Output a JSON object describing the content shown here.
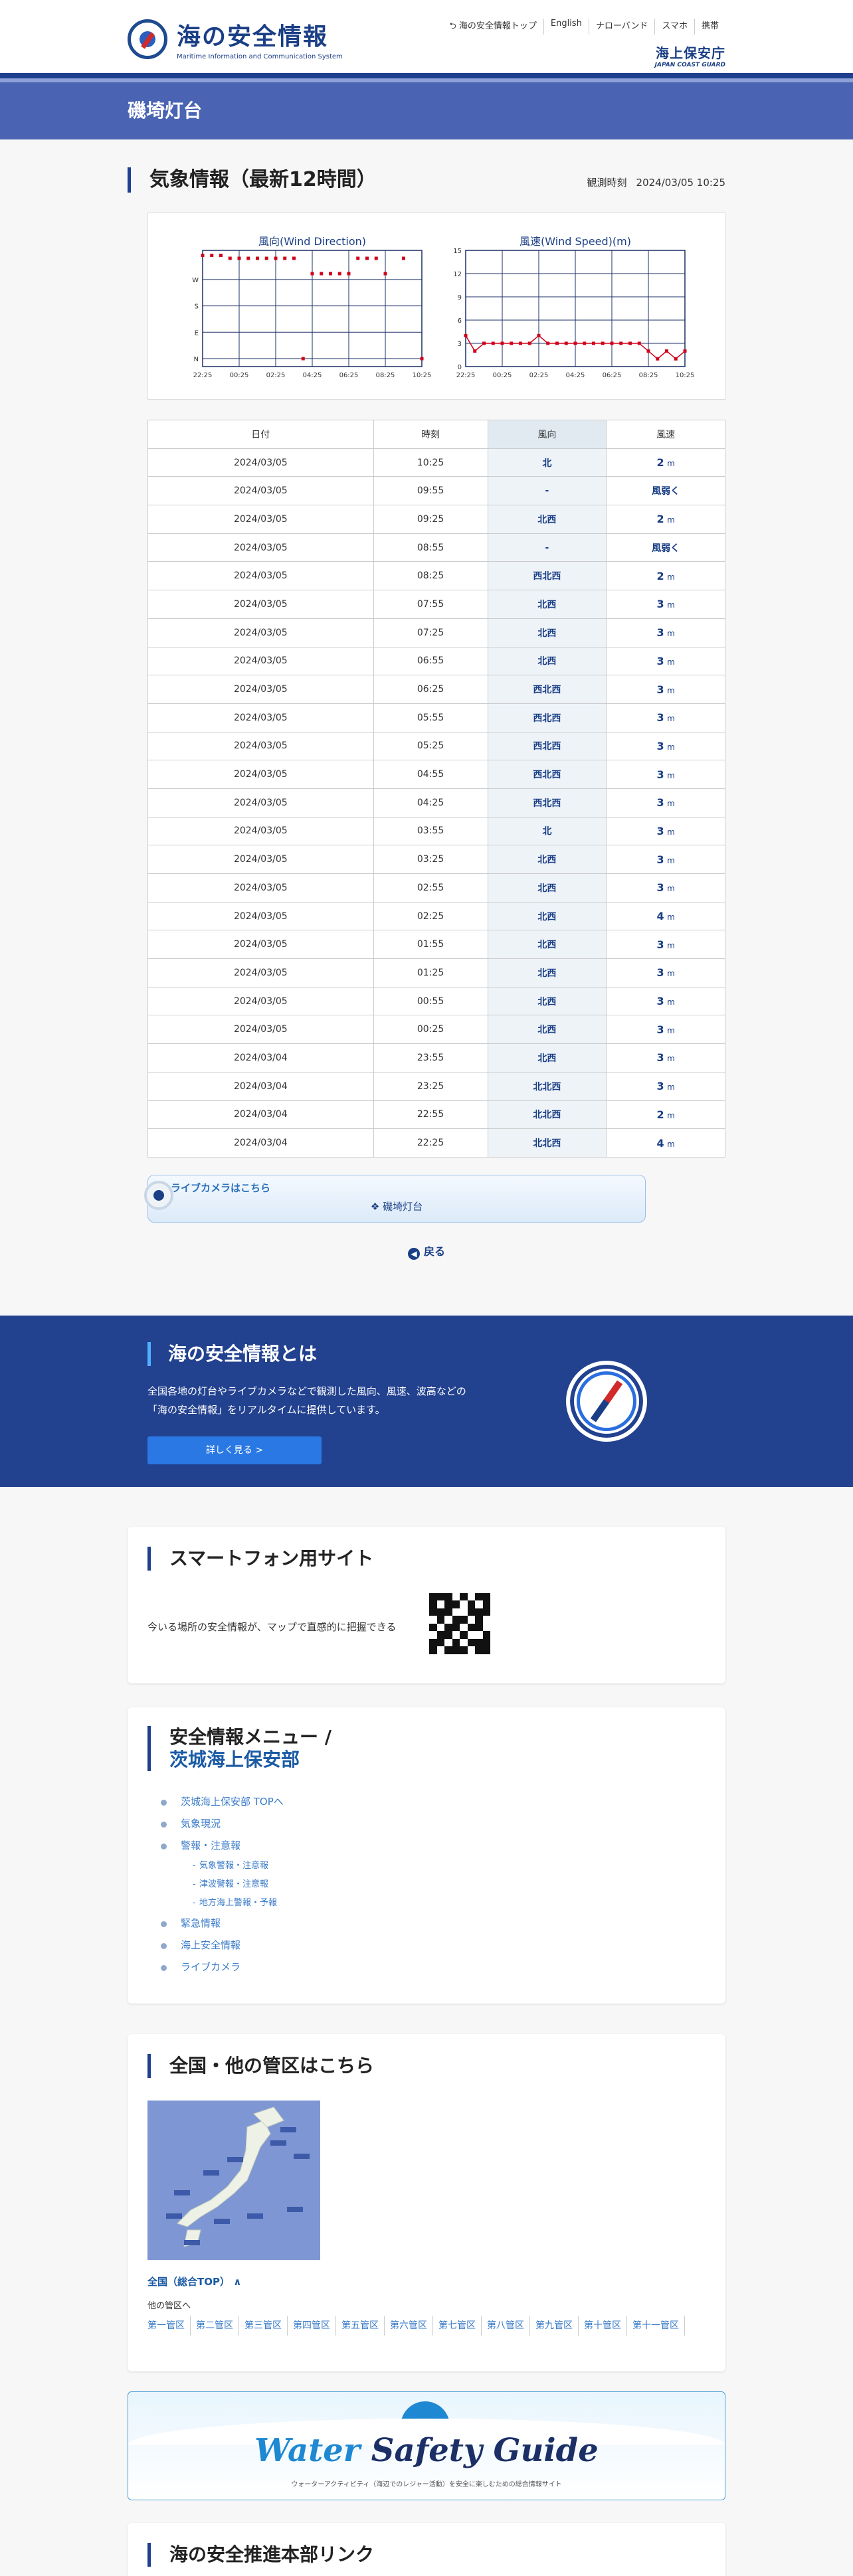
{
  "header": {
    "logo_title": "海の安全情報",
    "logo_sub": "Maritime Information and Communication System",
    "nav": [
      "⮌ 海の安全情報トップ",
      "English",
      "ナローバンド",
      "スマホ",
      "携帯"
    ],
    "jcg_title": "海上保安庁",
    "jcg_en": "JAPAN COAST GUARD"
  },
  "page_title": "磯埼灯台",
  "weather": {
    "title": "気象情報（最新12時間）",
    "obs_label": "観測時刻",
    "obs_time": "2024/03/05 10:25",
    "columns": [
      "日付",
      "時刻",
      "風向",
      "風速"
    ],
    "unit": "m",
    "rows": [
      {
        "date": "2024/03/05",
        "time": "10:25",
        "dir": "北",
        "speed": "2",
        "calm": ""
      },
      {
        "date": "2024/03/05",
        "time": "09:55",
        "dir": "-",
        "speed": "",
        "calm": "風弱く"
      },
      {
        "date": "2024/03/05",
        "time": "09:25",
        "dir": "北西",
        "speed": "2",
        "calm": ""
      },
      {
        "date": "2024/03/05",
        "time": "08:55",
        "dir": "-",
        "speed": "",
        "calm": "風弱く"
      },
      {
        "date": "2024/03/05",
        "time": "08:25",
        "dir": "西北西",
        "speed": "2",
        "calm": ""
      },
      {
        "date": "2024/03/05",
        "time": "07:55",
        "dir": "北西",
        "speed": "3",
        "calm": ""
      },
      {
        "date": "2024/03/05",
        "time": "07:25",
        "dir": "北西",
        "speed": "3",
        "calm": ""
      },
      {
        "date": "2024/03/05",
        "time": "06:55",
        "dir": "北西",
        "speed": "3",
        "calm": ""
      },
      {
        "date": "2024/03/05",
        "time": "06:25",
        "dir": "西北西",
        "speed": "3",
        "calm": ""
      },
      {
        "date": "2024/03/05",
        "time": "05:55",
        "dir": "西北西",
        "speed": "3",
        "calm": ""
      },
      {
        "date": "2024/03/05",
        "time": "05:25",
        "dir": "西北西",
        "speed": "3",
        "calm": ""
      },
      {
        "date": "2024/03/05",
        "time": "04:55",
        "dir": "西北西",
        "speed": "3",
        "calm": ""
      },
      {
        "date": "2024/03/05",
        "time": "04:25",
        "dir": "西北西",
        "speed": "3",
        "calm": ""
      },
      {
        "date": "2024/03/05",
        "time": "03:55",
        "dir": "北",
        "speed": "3",
        "calm": ""
      },
      {
        "date": "2024/03/05",
        "time": "03:25",
        "dir": "北西",
        "speed": "3",
        "calm": ""
      },
      {
        "date": "2024/03/05",
        "time": "02:55",
        "dir": "北西",
        "speed": "3",
        "calm": ""
      },
      {
        "date": "2024/03/05",
        "time": "02:25",
        "dir": "北西",
        "speed": "4",
        "calm": ""
      },
      {
        "date": "2024/03/05",
        "time": "01:55",
        "dir": "北西",
        "speed": "3",
        "calm": ""
      },
      {
        "date": "2024/03/05",
        "time": "01:25",
        "dir": "北西",
        "speed": "3",
        "calm": ""
      },
      {
        "date": "2024/03/05",
        "time": "00:55",
        "dir": "北西",
        "speed": "3",
        "calm": ""
      },
      {
        "date": "2024/03/05",
        "time": "00:25",
        "dir": "北西",
        "speed": "3",
        "calm": ""
      },
      {
        "date": "2024/03/04",
        "time": "23:55",
        "dir": "北西",
        "speed": "3",
        "calm": ""
      },
      {
        "date": "2024/03/04",
        "time": "23:25",
        "dir": "北北西",
        "speed": "3",
        "calm": ""
      },
      {
        "date": "2024/03/04",
        "time": "22:55",
        "dir": "北北西",
        "speed": "2",
        "calm": ""
      },
      {
        "date": "2024/03/04",
        "time": "22:25",
        "dir": "北北西",
        "speed": "4",
        "calm": ""
      }
    ]
  },
  "chart_data": [
    {
      "type": "scatter",
      "title": "風向(Wind Direction)",
      "y_ticks": [
        "N",
        "E",
        "S",
        "W"
      ],
      "x_ticks": [
        "22:25",
        "00:25",
        "02:25",
        "04:25",
        "06:25",
        "08:25",
        "10:25"
      ],
      "x": [
        "22:25",
        "22:55",
        "23:25",
        "23:55",
        "00:25",
        "00:55",
        "01:25",
        "01:55",
        "02:25",
        "02:55",
        "03:25",
        "03:55",
        "04:25",
        "04:55",
        "05:25",
        "05:55",
        "06:25",
        "06:55",
        "07:25",
        "07:55",
        "08:25",
        "08:55",
        "09:25",
        "09:55",
        "10:25"
      ],
      "values": [
        340,
        340,
        340,
        315,
        315,
        315,
        315,
        315,
        315,
        315,
        315,
        0,
        290,
        290,
        290,
        290,
        290,
        315,
        315,
        315,
        290,
        null,
        315,
        null,
        0
      ],
      "color": "#d0021b"
    },
    {
      "type": "line",
      "title": "風速(Wind Speed)(m)",
      "ylim": [
        0,
        15
      ],
      "y_ticks": [
        0,
        3,
        6,
        9,
        12,
        15
      ],
      "x_ticks": [
        "22:25",
        "00:25",
        "02:25",
        "04:25",
        "06:25",
        "08:25",
        "10:25"
      ],
      "x": [
        "22:25",
        "22:55",
        "23:25",
        "23:55",
        "00:25",
        "00:55",
        "01:25",
        "01:55",
        "02:25",
        "02:55",
        "03:25",
        "03:55",
        "04:25",
        "04:55",
        "05:25",
        "05:55",
        "06:25",
        "06:55",
        "07:25",
        "07:55",
        "08:25",
        "08:55",
        "09:25",
        "09:55",
        "10:25"
      ],
      "values": [
        4,
        2,
        3,
        3,
        3,
        3,
        3,
        3,
        4,
        3,
        3,
        3,
        3,
        3,
        3,
        3,
        3,
        3,
        3,
        3,
        2,
        1,
        2,
        1,
        2
      ],
      "color": "#d0021b"
    }
  ],
  "livecam": {
    "label": "ライブカメラはこちら",
    "place": "❖ 磯埼灯台"
  },
  "back_label": "戻る",
  "about": {
    "title": "海の安全情報とは",
    "line1": "全国各地の灯台やライブカメラなどで観測した風向、風速、波高などの",
    "line2": "「海の安全情報」をリアルタイムに提供しています。",
    "button": "詳しく見る >"
  },
  "smartphone": {
    "title": "スマートフォン用サイト",
    "text": "今いる場所の安全情報が、マップで直感的に把握できる"
  },
  "menu": {
    "title": "安全情報メニュー /",
    "subtitle": "茨城海上保安部",
    "items": [
      "茨城海上保安部 TOPへ",
      "気象現況",
      "警報・注意報",
      "緊急情報",
      "海上安全情報",
      "ライブカメラ"
    ],
    "sub_items": [
      "気象警報・注意報",
      "津波警報・注意報",
      "地方海上警報・予報"
    ]
  },
  "regions": {
    "title": "全国・他の管区はこちら",
    "national": "全国（総合TOP） ∧",
    "other_label": "他の管区へ",
    "links": [
      "第一管区",
      "第二管区",
      "第三管区",
      "第四管区",
      "第五管区",
      "第六管区",
      "第七管区",
      "第八管区",
      "第九管区",
      "第十管区",
      "第十一管区"
    ]
  },
  "banner": {
    "word1": "Water",
    "word2": "Safety Guide",
    "caption": "ウォーターアクティビティ（海辺でのレジャー活動）を安全に楽しむための総合情報サイト"
  },
  "promo": {
    "title": "海の安全推進本部リンク"
  }
}
